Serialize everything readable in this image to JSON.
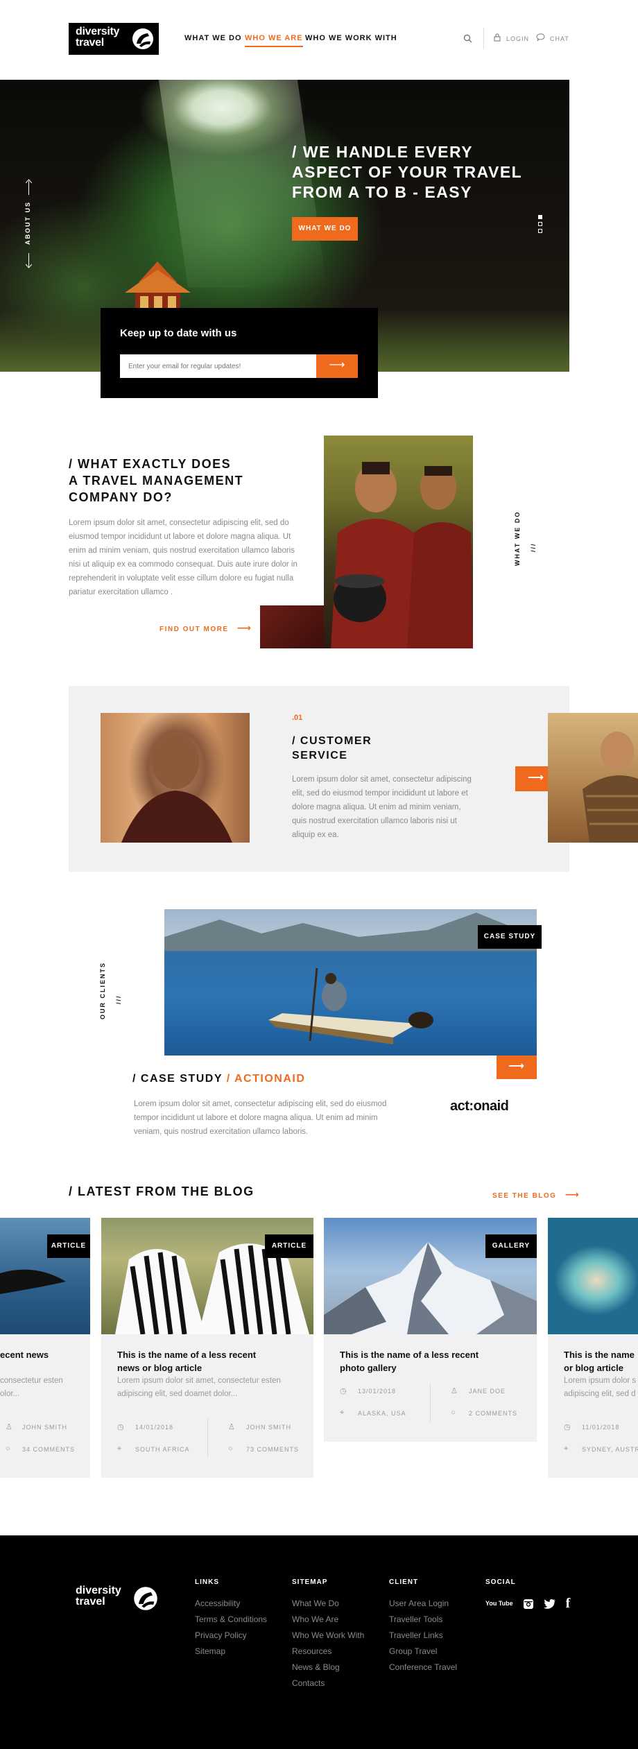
{
  "header": {
    "logo_line1": "diversity",
    "logo_line2": "travel",
    "nav": [
      "WHAT WE DO",
      "WHO WE ARE",
      "WHO WE WORK WITH"
    ],
    "login": "LOGIN",
    "chat": "CHAT"
  },
  "hero": {
    "title_line1": "/ WE HANDLE EVERY",
    "title_line2": "ASPECT OF YOUR TRAVEL",
    "title_line3": "FROM A TO B - EASY",
    "cta": "WHAT WE DO",
    "side_label": "ABOUT US",
    "subscribe_title": "Keep up to date with us",
    "subscribe_placeholder": "Enter your email for regular updates!"
  },
  "about": {
    "title_line1": "/ WHAT EXACTLY DOES",
    "title_line2": "A TRAVEL MANAGEMENT",
    "title_line3": "COMPANY DO?",
    "body": "Lorem ipsum dolor sit amet, consectetur adipiscing elit, sed do eiusmod tempor incididunt ut labore et dolore magna aliqua. Ut enim ad minim veniam, quis nostrud exercitation ullamco laboris nisi ut aliquip ex ea commodo consequat. Duis aute irure dolor in reprehenderit in voluptate velit esse cillum dolore eu fugiat nulla pariatur exercitation ullamco .",
    "link": "FIND OUT MORE",
    "side_label": "WHAT WE DO",
    "side_slashes": "///"
  },
  "service": {
    "number": ".01",
    "title_line1": "/ CUSTOMER",
    "title_line2": "SERVICE",
    "body": "Lorem ipsum dolor sit amet, consectetur adipiscing elit, sed do eiusmod tempor incididunt ut labore et dolore magna aliqua. Ut enim ad minim veniam, quis nostrud exercitation ullamco laboris nisi ut aliquip ex ea."
  },
  "case_study": {
    "tag": "CASE STUDY",
    "title_prefix": "/ CASE STUDY",
    "title_client": "/ ACTIONAID",
    "body": "Lorem ipsum dolor sit amet, consectetur adipiscing elit, sed do eiusmod tempor incididunt ut labore et dolore magna aliqua. Ut enim ad minim veniam, quis nostrud exercitation ullamco laboris.",
    "client_logo": "act:onaid",
    "side_label": "OUR CLIENTS",
    "side_slashes": "///"
  },
  "blog": {
    "title": "/ LATEST FROM THE BLOG",
    "see_all": "SEE THE BLOG",
    "cards": [
      {
        "tag": "ARTICLE",
        "title_line1": "ecent news",
        "title_line2": "",
        "text_line1": "consectetur esten",
        "text_line2": "olor...",
        "author": "JOHN SMITH",
        "comments": "34 COMMENTS"
      },
      {
        "tag": "ARTICLE",
        "title_line1": "This is the name of a less recent",
        "title_line2": "news or blog article",
        "text_line1": "Lorem ipsum dolor sit amet, consectetur esten",
        "text_line2": "adipiscing elit, sed doamet dolor...",
        "date": "14/01/2018",
        "location": "SOUTH AFRICA",
        "author": "JOHN SMITH",
        "comments": "73 COMMENTS"
      },
      {
        "tag": "GALLERY",
        "title_line1": "This is the name of a less recent",
        "title_line2": "photo gallery",
        "date": "13/01/2018",
        "location": "ALASKA, USA",
        "author": "JANE DOE",
        "comments": "2 COMMENTS"
      },
      {
        "title_line1": "This is the name",
        "title_line2": "or blog article",
        "text_line1": "Lorem ipsum dolor s",
        "text_line2": "adipiscing elit, sed d",
        "date": "11/01/2018",
        "location": "SYDNEY, AUSTRA"
      }
    ]
  },
  "footer": {
    "logo_line1": "diversity",
    "logo_line2": "travel",
    "links_head": "LINKS",
    "links": [
      "Accessibility",
      "Terms & Conditions",
      "Privacy Policy",
      "Sitemap"
    ],
    "sitemap_head": "SITEMAP",
    "sitemap": [
      "What We Do",
      "Who We Are",
      "Who We Work With",
      "Resources",
      "News & Blog",
      "Contacts"
    ],
    "client_head": "CLIENT",
    "client": [
      "User Area Login",
      "Traveller Tools",
      "Traveller Links",
      "Group Travel",
      "Conference Travel"
    ],
    "social_head": "SOCIAL",
    "social": [
      "You Tube",
      "Instagram",
      "Twitter",
      "Facebook"
    ]
  },
  "colors": {
    "accent": "#ef6a1d",
    "dark": "#000000",
    "panel": "#f1f1f1",
    "muted": "#8a8a8a"
  }
}
